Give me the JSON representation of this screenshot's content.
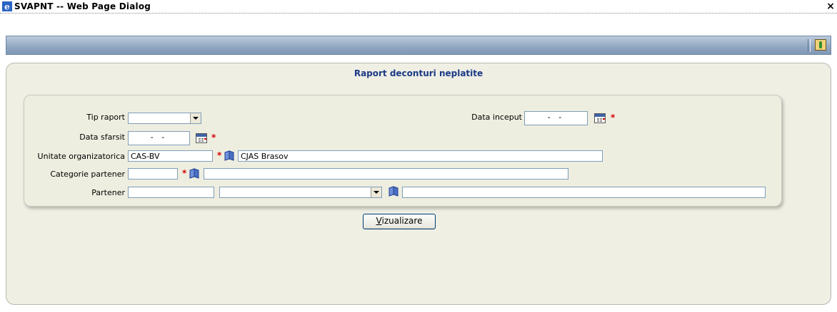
{
  "window": {
    "title": "SVAPNT -- Web Page Dialog",
    "close_label": "×"
  },
  "toolbar": {
    "help_icon": "help-icon"
  },
  "panel": {
    "title": "Raport deconturi neplatite"
  },
  "form": {
    "tip_raport": {
      "label": "Tip raport",
      "value": ""
    },
    "data_inceput": {
      "label": "Data inceput",
      "value": "- -"
    },
    "data_sfarsit": {
      "label": "Data sfarsit",
      "value": "- -"
    },
    "unitate": {
      "label": "Unitate organizatorica",
      "code": "CAS-BV",
      "name": "CJAS Brasov"
    },
    "categorie": {
      "label": "Categorie partener",
      "code": "",
      "name": ""
    },
    "partener": {
      "label": "Partener",
      "code": "",
      "select": "",
      "name": ""
    },
    "required_mark": "*"
  },
  "actions": {
    "vizualizare_first": "V",
    "vizualizare_rest": "izualizare"
  },
  "colors": {
    "panel_title": "#1c3a86",
    "required": "#d40000",
    "toolbar": "#90a7c1"
  }
}
